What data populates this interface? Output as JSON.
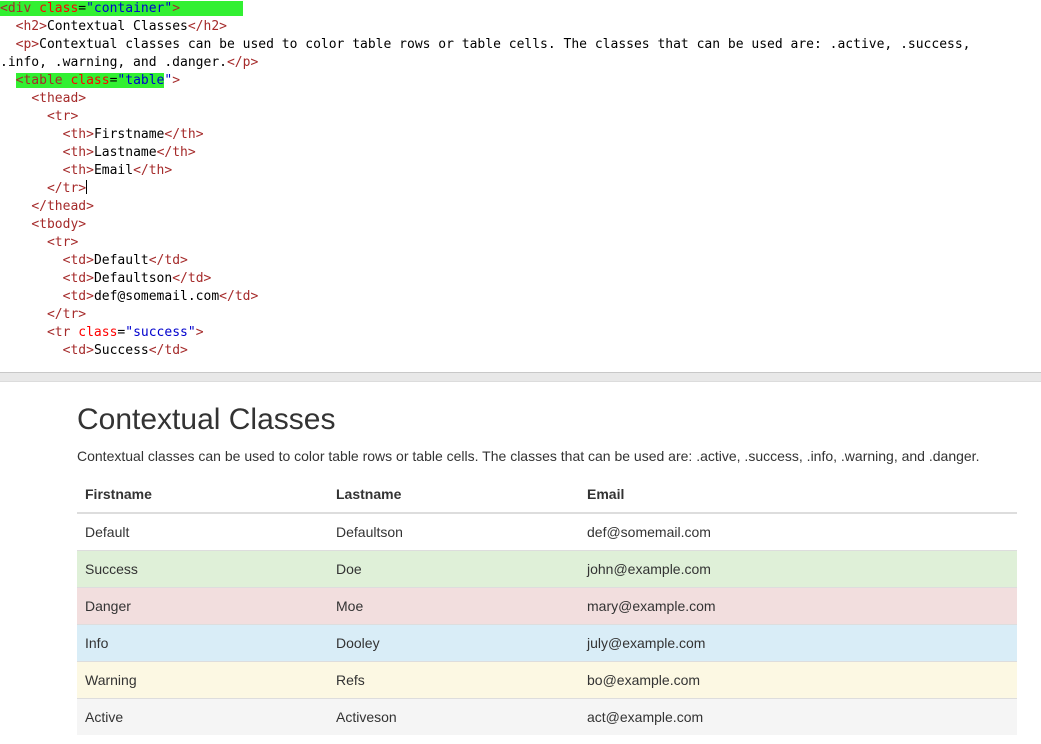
{
  "editor": {
    "lines": [
      {
        "parts": [
          {
            "t": "<",
            "c": "tag hl"
          },
          {
            "t": "div",
            "c": "tag hl"
          },
          {
            "t": " ",
            "c": "hl"
          },
          {
            "t": "class",
            "c": "attr hl"
          },
          {
            "t": "=",
            "c": "txt hl"
          },
          {
            "t": "\"container\"",
            "c": "val hl"
          },
          {
            "t": ">",
            "c": "tag hl"
          },
          {
            "t": "        ",
            "c": "hl"
          }
        ]
      },
      {
        "indent": "  ",
        "parts": [
          {
            "t": "<h2>",
            "c": "tag"
          },
          {
            "t": "Contextual Classes",
            "c": "txt"
          },
          {
            "t": "</h2>",
            "c": "tag"
          }
        ]
      },
      {
        "indent": "  ",
        "parts": [
          {
            "t": "<p>",
            "c": "tag"
          },
          {
            "t": "Contextual classes can be used to color table rows or table cells. The classes that can be used are: .active, .success,",
            "c": "txt"
          }
        ]
      },
      {
        "indent": "",
        "parts": [
          {
            "t": ".info, .warning, and .danger.",
            "c": "txt"
          },
          {
            "t": "</p>",
            "c": "tag"
          }
        ]
      },
      {
        "indent": "  ",
        "parts": [
          {
            "t": "<table",
            "c": "tag hl"
          },
          {
            "t": " ",
            "c": "hl"
          },
          {
            "t": "class",
            "c": "attr hl"
          },
          {
            "t": "=",
            "c": "txt hl"
          },
          {
            "t": "\"table",
            "c": "val hl"
          },
          {
            "t": "\"",
            "c": "val"
          },
          {
            "t": ">",
            "c": "tag"
          }
        ]
      },
      {
        "indent": "    ",
        "parts": [
          {
            "t": "<thead>",
            "c": "tag"
          }
        ]
      },
      {
        "indent": "      ",
        "parts": [
          {
            "t": "<tr>",
            "c": "tag"
          }
        ]
      },
      {
        "indent": "        ",
        "parts": [
          {
            "t": "<th>",
            "c": "tag"
          },
          {
            "t": "Firstname",
            "c": "txt"
          },
          {
            "t": "</th>",
            "c": "tag"
          }
        ]
      },
      {
        "indent": "        ",
        "parts": [
          {
            "t": "<th>",
            "c": "tag"
          },
          {
            "t": "Lastname",
            "c": "txt"
          },
          {
            "t": "</th>",
            "c": "tag"
          }
        ]
      },
      {
        "indent": "        ",
        "parts": [
          {
            "t": "<th>",
            "c": "tag"
          },
          {
            "t": "Email",
            "c": "txt"
          },
          {
            "t": "</th>",
            "c": "tag"
          }
        ]
      },
      {
        "indent": "      ",
        "parts": [
          {
            "t": "</tr>",
            "c": "tag"
          }
        ],
        "caret": true
      },
      {
        "indent": "    ",
        "parts": [
          {
            "t": "</thead>",
            "c": "tag"
          }
        ]
      },
      {
        "indent": "    ",
        "parts": [
          {
            "t": "<tbody>",
            "c": "tag"
          }
        ]
      },
      {
        "indent": "      ",
        "parts": [
          {
            "t": "<tr>",
            "c": "tag"
          }
        ]
      },
      {
        "indent": "        ",
        "parts": [
          {
            "t": "<td>",
            "c": "tag"
          },
          {
            "t": "Default",
            "c": "txt"
          },
          {
            "t": "</td>",
            "c": "tag"
          }
        ]
      },
      {
        "indent": "        ",
        "parts": [
          {
            "t": "<td>",
            "c": "tag"
          },
          {
            "t": "Defaultson",
            "c": "txt"
          },
          {
            "t": "</td>",
            "c": "tag"
          }
        ]
      },
      {
        "indent": "        ",
        "parts": [
          {
            "t": "<td>",
            "c": "tag"
          },
          {
            "t": "def@somemail.com",
            "c": "txt"
          },
          {
            "t": "</td>",
            "c": "tag"
          }
        ]
      },
      {
        "indent": "      ",
        "parts": [
          {
            "t": "</tr>",
            "c": "tag"
          }
        ]
      },
      {
        "indent": "      ",
        "parts": [
          {
            "t": "<tr",
            "c": "tag"
          },
          {
            "t": " ",
            "c": "txt"
          },
          {
            "t": "class",
            "c": "attr"
          },
          {
            "t": "=",
            "c": "txt"
          },
          {
            "t": "\"success\"",
            "c": "val"
          },
          {
            "t": ">",
            "c": "tag"
          }
        ]
      },
      {
        "indent": "        ",
        "parts": [
          {
            "t": "<td>",
            "c": "tag"
          },
          {
            "t": "Success",
            "c": "txt"
          },
          {
            "t": "</td>",
            "c": "tag"
          }
        ]
      }
    ]
  },
  "preview": {
    "title": "Contextual Classes",
    "description": "Contextual classes can be used to color table rows or table cells. The classes that can be used are: .active, .success, .info, .warning, and .danger.",
    "table": {
      "headers": [
        "Firstname",
        "Lastname",
        "Email"
      ],
      "rows": [
        {
          "context": "default",
          "bg": "#ffffff",
          "cells": [
            "Default",
            "Defaultson",
            "def@somemail.com"
          ]
        },
        {
          "context": "success",
          "bg": "#dff0d8",
          "cells": [
            "Success",
            "Doe",
            "john@example.com"
          ]
        },
        {
          "context": "danger",
          "bg": "#f2dede",
          "cells": [
            "Danger",
            "Moe",
            "mary@example.com"
          ]
        },
        {
          "context": "info",
          "bg": "#d9edf7",
          "cells": [
            "Info",
            "Dooley",
            "july@example.com"
          ]
        },
        {
          "context": "warning",
          "bg": "#fcf8e3",
          "cells": [
            "Warning",
            "Refs",
            "bo@example.com"
          ]
        },
        {
          "context": "active",
          "bg": "#f5f5f5",
          "cells": [
            "Active",
            "Activeson",
            "act@example.com"
          ]
        }
      ]
    }
  },
  "colors": {
    "highlight": "#32f032",
    "tag": "#a52a2a",
    "attribute": "#ff0000",
    "attribute_value": "#0000cd"
  }
}
